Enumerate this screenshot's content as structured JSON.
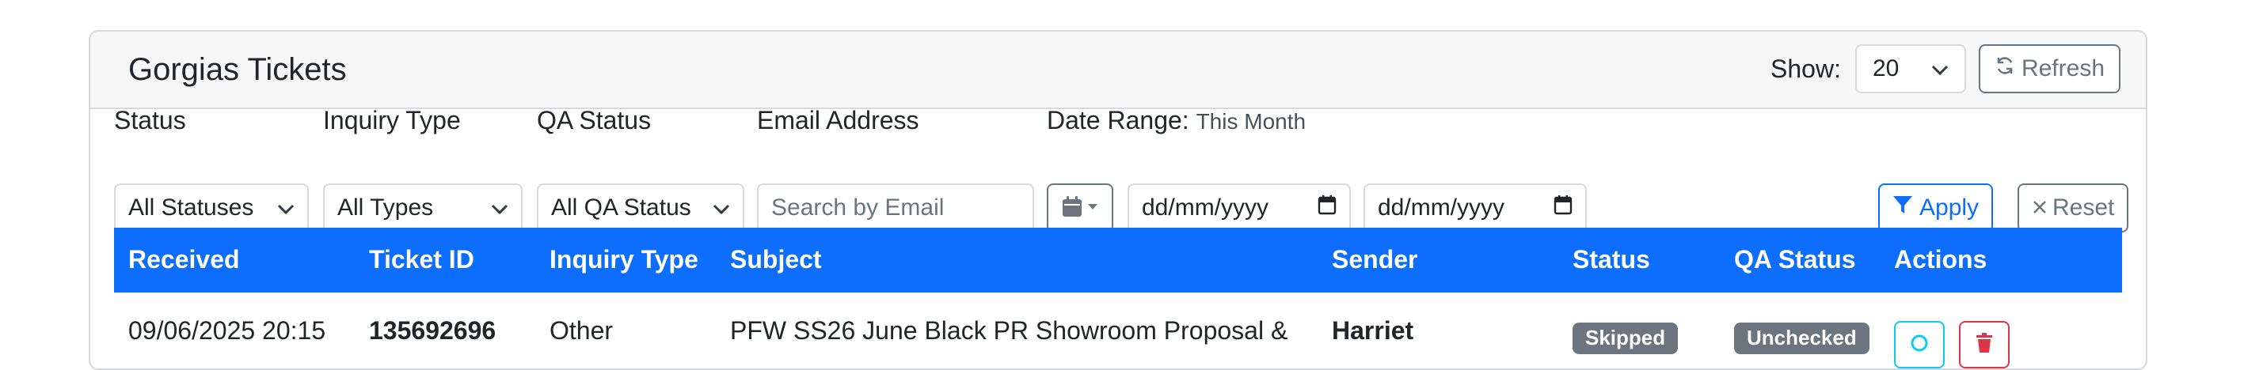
{
  "header": {
    "title": "Gorgias Tickets",
    "show_label": "Show:",
    "show_value": "20",
    "refresh_label": "Refresh"
  },
  "filters": {
    "status": {
      "label": "Status",
      "value": "All Statuses"
    },
    "inquiry_type": {
      "label": "Inquiry Type",
      "value": "All Types"
    },
    "qa_status": {
      "label": "QA Status",
      "value": "All QA Status"
    },
    "email": {
      "label": "Email Address",
      "placeholder": "Search by Email"
    },
    "date_range": {
      "label": "Date Range:",
      "current": "This Month",
      "from_placeholder": "dd/mm/yyyy",
      "to_placeholder": "dd/mm/yyyy"
    },
    "apply_label": "Apply",
    "reset_label": "Reset"
  },
  "table": {
    "columns": [
      "Received",
      "Ticket ID",
      "Inquiry Type",
      "Subject",
      "Sender",
      "Status",
      "QA Status",
      "Actions"
    ],
    "rows": [
      {
        "received": "09/06/2025 20:15",
        "ticket_id": "135692696",
        "inquiry_type": "Other",
        "subject": "PFW SS26 June Black PR Showroom Proposal &",
        "sender": "Harriet",
        "status": "Skipped",
        "qa_status": "Unchecked"
      }
    ]
  },
  "colors": {
    "primary": "#0d6efd",
    "secondary": "#6c757d",
    "danger": "#dc3545",
    "info": "#0dcaf0"
  },
  "icons": {
    "refresh": "refresh-icon",
    "select_chevron": "chevron-down-icon",
    "calendar": "calendar-icon",
    "calendar_caret": "caret-down-icon",
    "filter": "filter-icon",
    "reset": "close-icon",
    "view": "view-icon",
    "delete": "trash-icon"
  }
}
